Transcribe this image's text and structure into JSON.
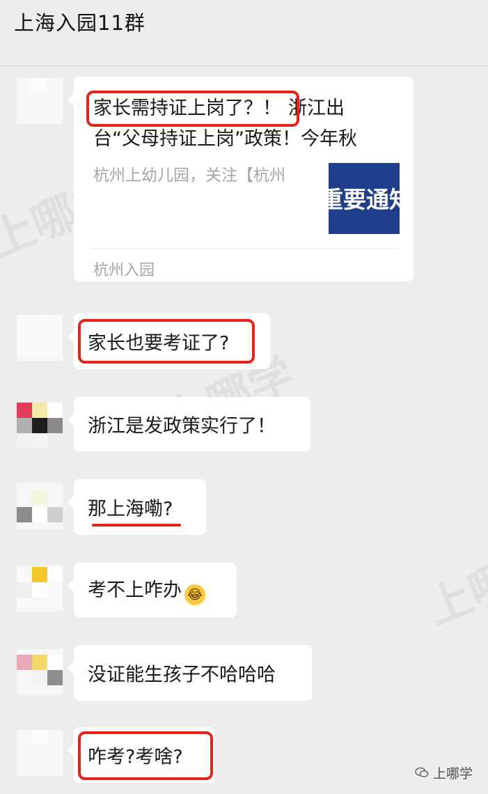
{
  "window": {
    "title": "上海入园11群"
  },
  "watermark": {
    "text": "上哪学"
  },
  "messages": [
    {
      "type": "article",
      "title_boxed": "家长需持证上岗了？！",
      "title_rest_line1": "浙江出",
      "title_line2": "台“父母持证上岗”政策！今年秋",
      "description": "杭州上幼儿园，关注【杭州",
      "thumbnail_text": "重要通知",
      "source": "杭州入园",
      "highlight": "box"
    },
    {
      "type": "text",
      "text": "家长也要考证了?",
      "highlight": "box"
    },
    {
      "type": "text",
      "text": "浙江是发政策实行了！",
      "highlight": "none"
    },
    {
      "type": "text",
      "text": "那上海嘞?",
      "highlight": "underline"
    },
    {
      "type": "text",
      "text": "考不上咋办",
      "emoji": "crying-laughing-face",
      "highlight": "none"
    },
    {
      "type": "text",
      "text": "没证能生孩子不哈哈哈",
      "highlight": "none"
    },
    {
      "type": "text",
      "text": "咋考?考啥?",
      "highlight": "box"
    }
  ],
  "footer": {
    "brand": "上哪学",
    "icon": "wechat-icon"
  },
  "colors": {
    "highlight_red": "#e2251a",
    "background": "#ededed",
    "bubble": "#ffffff",
    "thumbnail_bg": "#1f3e8c",
    "emoji_yellow": "#ffc83d"
  }
}
